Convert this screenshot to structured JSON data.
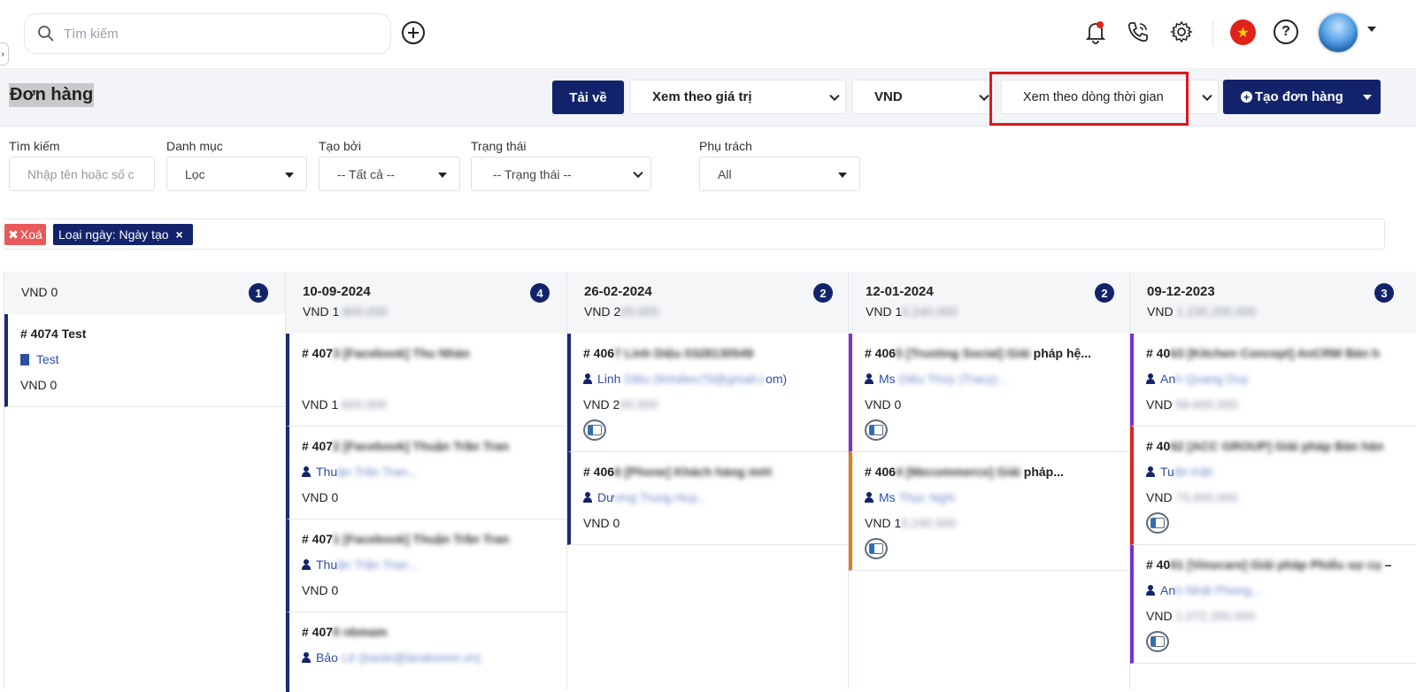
{
  "topbar": {
    "search_placeholder": "Tìm kiếm",
    "icons": [
      "search-icon",
      "add-circle-icon",
      "bell-icon",
      "phone-call-icon",
      "gear-icon",
      "vietnam-flag-icon",
      "help-icon",
      "avatar"
    ],
    "flag_glyph": "★",
    "help_glyph": "?"
  },
  "header": {
    "title": "Đơn hàng",
    "download_label": "Tải về",
    "view_by_value": "Xem theo giá trị",
    "currency": "VND",
    "view_by_timeline": "Xem theo dòng thời gian",
    "create_order_label": "Tạo đơn hàng"
  },
  "filters": {
    "search_label": "Tìm kiếm",
    "search_placeholder": "Nhập tên hoặc số c",
    "category_label": "Danh mục",
    "category_value": "Lọc",
    "created_by_label": "Tạo bởi",
    "created_by_value": "-- Tất cả --",
    "status_label": "Trạng thái",
    "status_value": "-- Trạng thái --",
    "owner_label": "Phụ trách",
    "owner_value": "All"
  },
  "tagbar": {
    "clear_label": "Xoá",
    "tag_label": "Loại ngày: Ngày tạo"
  },
  "colors": {
    "brand": "#13236b",
    "highlight": "#d8191d",
    "purple": "#7b2fd6",
    "orange": "#e07a1a",
    "red": "#e02424"
  },
  "board": {
    "columns": [
      {
        "date": "",
        "total": "VND 0",
        "count": "1",
        "cards": [
          {
            "title": "# 4074 Test",
            "who": "Test",
            "amount": "VND 0"
          }
        ]
      },
      {
        "date": "10-09-2024",
        "total": "VND 1",
        "total_blur": ".600.000",
        "count": "4",
        "cards": [
          {
            "title": "# 407",
            "title_blur": "3 [Facebook] Thu Nhàn",
            "who": "",
            "who_blur": "",
            "amount": "VND 1",
            "amount_blur": ".600.000"
          },
          {
            "title": "# 407",
            "title_blur": "2 [Facebook] Thuận Trần Tran",
            "who": "Thu",
            "who_blur": "ận Trần Tran...",
            "amount": "VND 0",
            "amount_blur": ""
          },
          {
            "title": "# 407",
            "title_blur": "1 [Facebook] Thuận Trần Tran",
            "who": "Thu",
            "who_blur": "ận Trần Tran...",
            "amount": "VND 0",
            "amount_blur": ""
          },
          {
            "title": "# 407",
            "title_blur": "0 nbmam",
            "who": "Bảo",
            "who_blur": " Lê (baole@larakomm.vn)",
            "amount": "",
            "amount_blur": ""
          }
        ]
      },
      {
        "date": "26-02-2024",
        "total": "VND 2",
        "total_blur": "00.000",
        "count": "2",
        "cards": [
          {
            "title": "# 406",
            "title_blur": "7 Linh Diệu 0328130549",
            "who": "Linh",
            "who_blur": " Diệu (linhdieu79@gmail.c",
            "who_tail": "om)",
            "amount": "VND 2",
            "amount_blur": "00.000"
          },
          {
            "title": "# 406",
            "title_blur": "6 [Phone] Khách hàng mới",
            "who": "Dư",
            "who_blur": "ơng Trung Huy...",
            "amount": "VND 0",
            "amount_blur": ""
          }
        ]
      },
      {
        "date": "12-01-2024",
        "total": "VND 1",
        "total_blur": "5.240.000",
        "count": "2",
        "cards": [
          {
            "title": "# 406",
            "title_blur": "5 [Trusting Social] Giải",
            "title_tail": "pháp hệ...",
            "who": "Ms",
            "who_blur": " Diệu Thùy (Tracy)...",
            "amount": "VND 0",
            "amount_blur": ""
          },
          {
            "title": "# 406",
            "title_blur": "4 [Mecommerce] Giải",
            "title_tail": "pháp...",
            "who": "Ms",
            "who_blur": " Thục Nghi",
            "amount": "VND 1",
            "amount_blur": "5.240.000"
          }
        ]
      },
      {
        "date": "09-12-2023",
        "total": "VND",
        "total_blur": " 1.235.200.000",
        "count": "3",
        "cards": [
          {
            "title": "# 40",
            "title_blur": "63 [Kitchen Concept] AnCRM Bán h",
            "who": "An",
            "who_blur": "h Quang Duy",
            "amount": "VND",
            "amount_blur": " 59.600.000"
          },
          {
            "title": "# 40",
            "title_blur": "62 [ACC GROUP] Giải pháp Bán hàn",
            "who": "Tu",
            "who_blur": "ấn Kiệt",
            "amount": "VND",
            "amount_blur": " 73.400.000"
          },
          {
            "title": "# 40",
            "title_blur": "61 [Vinscare] Giải pháp Phiếu sự cụ",
            "title_tail": "–",
            "who": "An",
            "who_blur": "h Nhật Phong...",
            "amount": "VND",
            "amount_blur": " 1.072.200.000"
          }
        ]
      }
    ]
  }
}
